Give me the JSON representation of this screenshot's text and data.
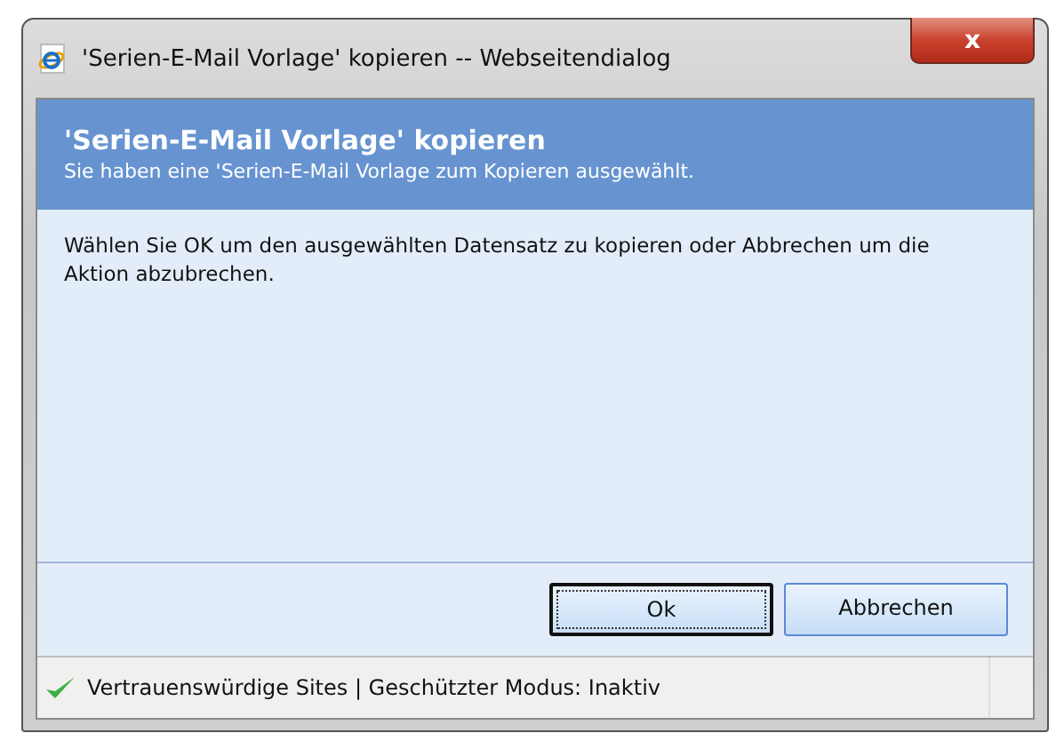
{
  "window": {
    "title": "'Serien-E-Mail Vorlage' kopieren -- Webseitendialog",
    "close": "x"
  },
  "header": {
    "title": "'Serien-E-Mail Vorlage' kopieren",
    "subtitle": "Sie haben eine 'Serien-E-Mail Vorlage zum Kopieren ausgewählt."
  },
  "message": "Wählen Sie OK um den ausgewählten Datensatz zu kopieren oder Abbrechen um die Aktion abzubrechen.",
  "buttons": [
    {
      "label": "Ok",
      "focused": true
    },
    {
      "label": "Abbrechen",
      "focused": false
    }
  ],
  "status_bar": {
    "text": "Vertrauenswürdige Sites | Geschützter Modus: Inaktiv"
  }
}
